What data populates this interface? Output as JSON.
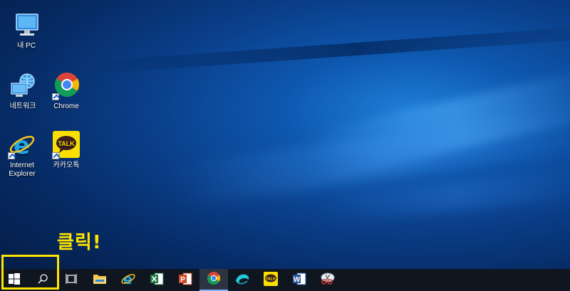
{
  "desktop": {
    "icons": [
      {
        "label": "내 PC",
        "icon": "this-pc-icon"
      },
      {
        "label": "네트워크",
        "icon": "network-icon"
      },
      {
        "label": "Chrome",
        "icon": "chrome-icon"
      },
      {
        "label": "Internet\nExplorer",
        "icon": "internet-explorer-icon"
      },
      {
        "label": "카카오톡",
        "icon": "kakaotalk-icon"
      }
    ]
  },
  "annotation": {
    "callout": "클릭!",
    "highlight_color": "#ffe400"
  },
  "taskbar": {
    "items": [
      {
        "name": "start",
        "icon": "windows-icon"
      },
      {
        "name": "search",
        "icon": "search-icon"
      },
      {
        "name": "task-view",
        "icon": "task-view-icon"
      },
      {
        "name": "file-explorer",
        "icon": "folder-icon"
      },
      {
        "name": "internet-explorer",
        "icon": "internet-explorer-icon"
      },
      {
        "name": "excel",
        "icon": "excel-icon"
      },
      {
        "name": "powerpoint",
        "icon": "powerpoint-icon"
      },
      {
        "name": "chrome",
        "icon": "chrome-icon",
        "active": true
      },
      {
        "name": "edge-app",
        "icon": "swirl-app-icon"
      },
      {
        "name": "kakaotalk",
        "icon": "kakaotalk-icon"
      },
      {
        "name": "word",
        "icon": "word-icon"
      },
      {
        "name": "snipping-tool",
        "icon": "scissors-icon"
      }
    ],
    "kakao_badge": "TALK"
  }
}
